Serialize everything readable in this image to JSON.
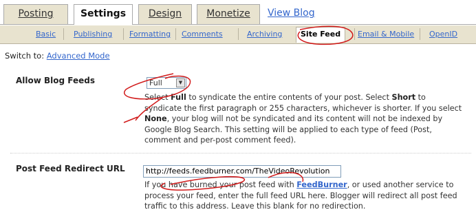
{
  "main_tabs": [
    {
      "label": "Posting"
    },
    {
      "label": "Settings"
    },
    {
      "label": "Design"
    },
    {
      "label": "Monetize"
    }
  ],
  "view_blog": "View Blog",
  "sub_tabs": [
    {
      "label": "Basic"
    },
    {
      "label": "Publishing"
    },
    {
      "label": "Formatting"
    },
    {
      "label": "Comments"
    },
    {
      "label": "Archiving"
    },
    {
      "label": "Site Feed"
    },
    {
      "label": "Email & Mobile"
    },
    {
      "label": "OpenID"
    }
  ],
  "switch": {
    "prefix": "Switch to:",
    "link": "Advanced Mode"
  },
  "allow_feeds": {
    "label": "Allow Blog Feeds",
    "selected": "Full",
    "help": {
      "t1": "Select ",
      "full": "Full",
      "t2": " to syndicate the entire contents of your post. Select ",
      "short": "Short",
      "t3": " to syndicate the first paragraph or 255 characters, whichever is shorter. If you select ",
      "none": "None",
      "t4": ", your blog will not be syndicated and its content will not be indexed by Google Blog Search. This setting will be applied to each type of feed (Post, comment and per-post comment feed)."
    }
  },
  "redirect": {
    "label": "Post Feed Redirect URL",
    "value": "http://feeds.feedburner.com/TheVideoRevolution",
    "help": {
      "t1": "If you have burned your post feed with ",
      "link": "FeedBurner",
      "t2": ", or used another service to process your feed, enter the full feed URL here. Blogger will redirect all post feed traffic to this address. Leave this blank for no redirection."
    }
  },
  "colors": {
    "link": "#3366cc",
    "tab_bg": "#e8e3cf",
    "annotation": "#d11a1a"
  }
}
